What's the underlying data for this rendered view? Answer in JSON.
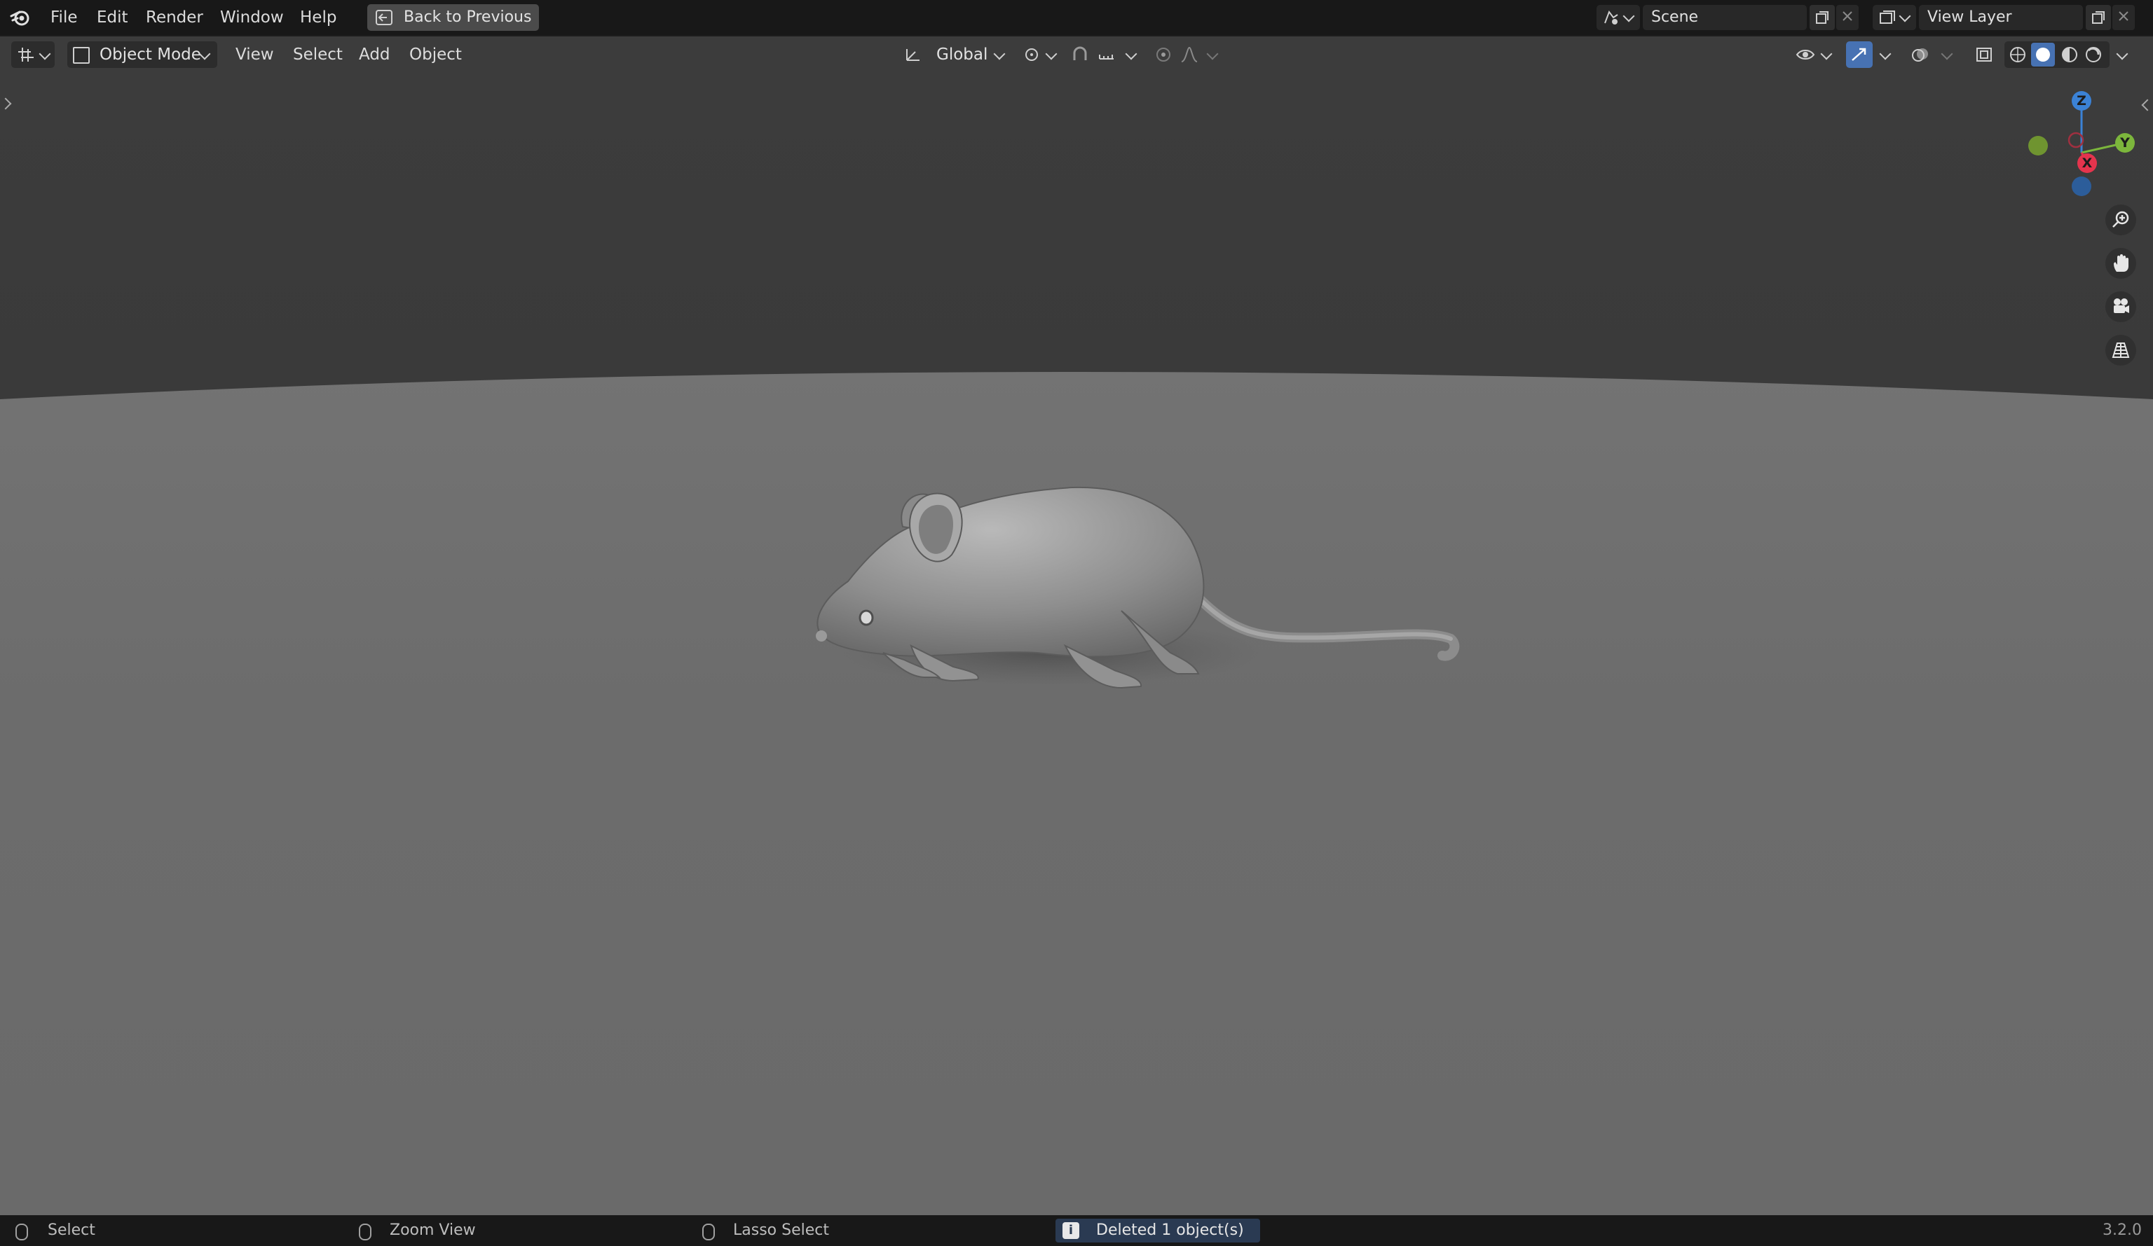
{
  "menubar": {
    "items": [
      "File",
      "Edit",
      "Render",
      "Window",
      "Help"
    ],
    "back_button": "Back to Previous",
    "scene": {
      "name": "Scene"
    },
    "view_layer": {
      "name": "View Layer"
    }
  },
  "viewport_header": {
    "mode": "Object Mode",
    "menus": [
      "View",
      "Select",
      "Add",
      "Object"
    ],
    "transform_orientation": "Global"
  },
  "gizmo": {
    "z_label": "Z",
    "y_label": "Y",
    "x_label": "X"
  },
  "icons": {
    "app": "blender-logo-icon",
    "back": "back-arrow-icon",
    "zoom": "zoom-in-icon",
    "pan": "hand-icon",
    "camera": "camera-icon",
    "perspective": "grid-perspective-icon"
  },
  "statusbar": {
    "left_click": "Select",
    "middle": "Zoom View",
    "right_click": "Lasso Select",
    "message": "Deleted 1 object(s)",
    "version": "3.2.0"
  },
  "colors": {
    "accent_blue": "#4772b3",
    "axis_x": "#e5344d",
    "axis_y": "#7cb63c",
    "axis_z": "#3b82d6",
    "floor": "#6e6e6e",
    "sky": "#393939"
  }
}
